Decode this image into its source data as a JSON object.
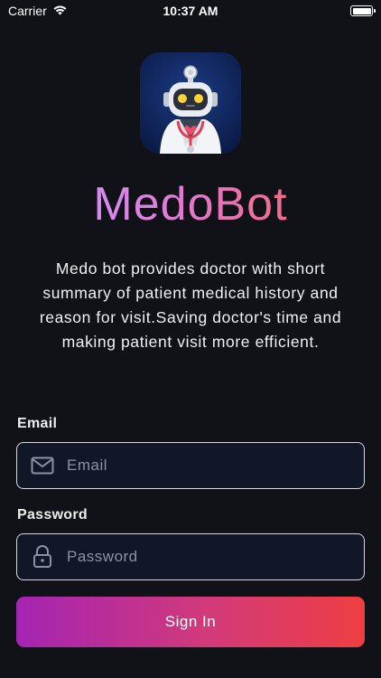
{
  "status_bar": {
    "carrier": "Carrier",
    "time": "10:37 AM"
  },
  "app": {
    "title": "MedoBot",
    "description": "Medo bot provides doctor with short summary of patient medical history and reason for visit.Saving doctor's time and making patient visit more efficient."
  },
  "form": {
    "email_label": "Email",
    "email_placeholder": "Email",
    "email_value": "",
    "password_label": "Password",
    "password_placeholder": "Password",
    "password_value": "",
    "signin_label": "Sign In"
  },
  "colors": {
    "background": "#111218",
    "field_background": "#121728",
    "gradient_start": "#a424b3",
    "gradient_end": "#ef3e42",
    "logo_background": "#0d1f4d"
  }
}
